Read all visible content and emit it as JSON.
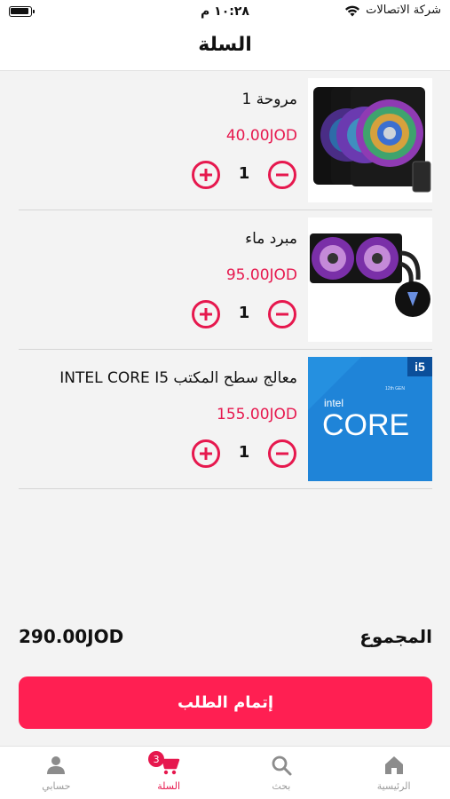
{
  "status_bar": {
    "time": "١٠:٢٨ م",
    "carrier": "شركة الاتصالات"
  },
  "header": {
    "title": "السلة"
  },
  "cart": {
    "items": [
      {
        "name": "مروحة 1",
        "price": "40.00JOD",
        "quantity": "1",
        "image": "rgb-case-fans-icon"
      },
      {
        "name": "مبرد ماء",
        "price": "95.00JOD",
        "quantity": "1",
        "image": "liquid-cooler-icon"
      },
      {
        "name": "معالج سطح المكتب INTEL CORE I5",
        "price": "155.00JOD",
        "quantity": "1",
        "image": "intel-core-i5-box-icon",
        "image_text": {
          "brand": "intel",
          "product": "CORE",
          "tier": "i5",
          "gen": "12th GEN"
        }
      }
    ]
  },
  "summary": {
    "total_label": "المجموع",
    "total_value": "290.00JOD"
  },
  "checkout": {
    "label": "إتمام الطلب"
  },
  "tabs": [
    {
      "label": "الرئيسية",
      "icon": "home-icon"
    },
    {
      "label": "بحث",
      "icon": "search-icon"
    },
    {
      "label": "السلة",
      "icon": "cart-icon",
      "active": true,
      "badge": "3"
    },
    {
      "label": "حسابي",
      "icon": "user-icon"
    }
  ],
  "colors": {
    "accent": "#e6184e",
    "button": "#ff1f52",
    "background": "#f3f3f3"
  }
}
